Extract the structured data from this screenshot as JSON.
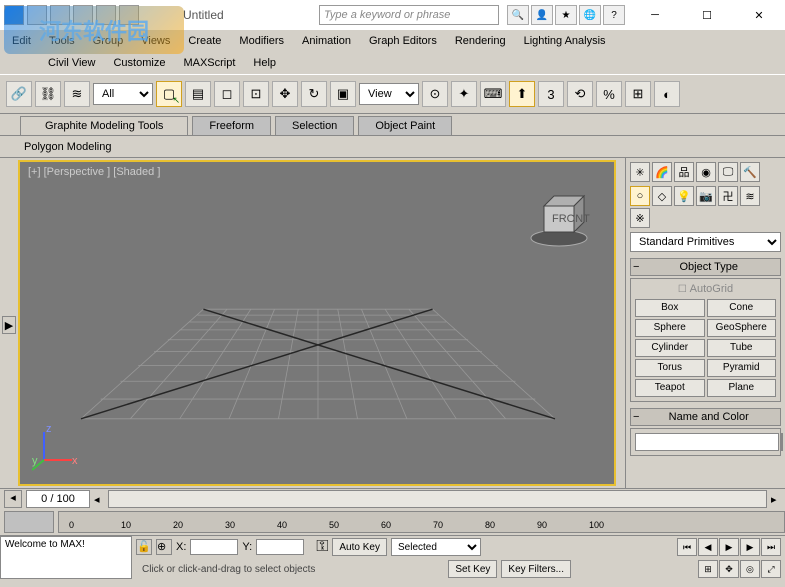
{
  "window": {
    "title": "Untitled",
    "search_placeholder": "Type a keyword or phrase"
  },
  "watermark": "河东软件园",
  "menu1": [
    "Edit",
    "Tools",
    "Group",
    "Views",
    "Create",
    "Modifiers",
    "Animation",
    "Graph Editors",
    "Rendering",
    "Lighting Analysis"
  ],
  "menu2": [
    "Civil View",
    "Customize",
    "MAXScript",
    "Help"
  ],
  "toolbar": {
    "all_dropdown": "All",
    "view_dropdown": "View"
  },
  "ribbon": {
    "tabs": [
      "Graphite Modeling Tools",
      "Freeform",
      "Selection",
      "Object Paint"
    ],
    "sub": "Polygon Modeling"
  },
  "viewport": {
    "label": "[+] [Perspective ] [Shaded ]",
    "axes": {
      "x": "x",
      "y": "y",
      "z": "z"
    }
  },
  "right_panel": {
    "category": "Standard Primitives",
    "object_type": {
      "header": "Object Type",
      "autogrid": "AutoGrid",
      "buttons": [
        [
          "Box",
          "Cone"
        ],
        [
          "Sphere",
          "GeoSphere"
        ],
        [
          "Cylinder",
          "Tube"
        ],
        [
          "Torus",
          "Pyramid"
        ],
        [
          "Teapot",
          "Plane"
        ]
      ]
    },
    "name_color": {
      "header": "Name and Color",
      "color": "#c82878"
    }
  },
  "timeline": {
    "frame_display": "0 / 100",
    "ticks": [
      0,
      10,
      20,
      30,
      40,
      50,
      60,
      70,
      80,
      90,
      100
    ]
  },
  "status": {
    "welcome": "Welcome to MAX!",
    "x_label": "X:",
    "y_label": "Y:",
    "autokey": "Auto Key",
    "setkey": "Set Key",
    "selected": "Selected",
    "keyfilters": "Key Filters...",
    "hint": "Click or click-and-drag to select objects"
  }
}
